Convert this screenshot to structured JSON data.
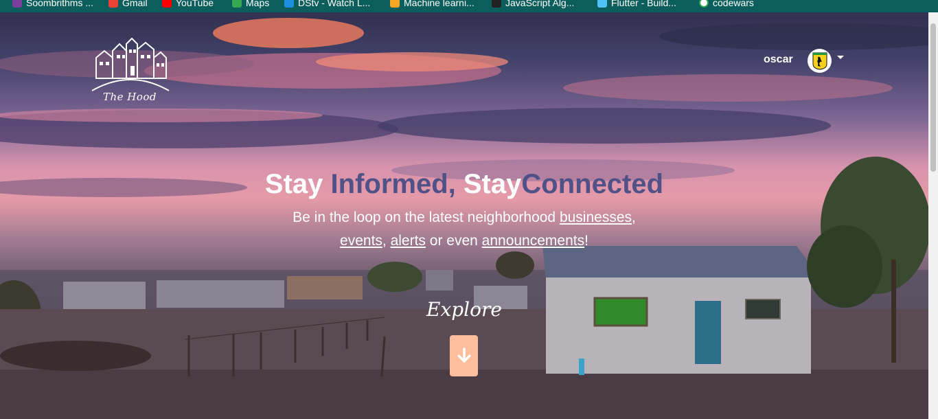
{
  "browser": {
    "bookmarks": [
      {
        "label": "Soombrithms ...",
        "icon": "music-icon"
      },
      {
        "label": "Gmail",
        "icon": "gmail-icon"
      },
      {
        "label": "YouTube",
        "icon": "youtube-icon"
      },
      {
        "label": "Maps",
        "icon": "maps-icon"
      },
      {
        "label": "DStv - Watch L...",
        "icon": "dstv-icon"
      },
      {
        "label": "Machine learni...",
        "icon": "ml-icon"
      },
      {
        "label": "JavaScript Alg...",
        "icon": "code-icon"
      },
      {
        "label": "Flutter - Build...",
        "icon": "flutter-icon"
      },
      {
        "label": "codewars",
        "icon": "codewars-icon"
      }
    ]
  },
  "nav": {
    "logo_text": "The Hood",
    "username": "oscar"
  },
  "hero": {
    "headline": {
      "part1": "Stay ",
      "part2": "Informed, ",
      "part3": "Stay",
      "part4": "Connected"
    },
    "tagline": {
      "intro": "Be in the loop on the latest neighborhood ",
      "link_businesses": "businesses",
      "sep1": ",",
      "link_events": "events",
      "sep2": ", ",
      "link_alerts": "alerts",
      "middle": " or even ",
      "link_announcements": "announcements",
      "end": "!"
    },
    "explore_label": "Explore"
  },
  "colors": {
    "bookmark_bar": "#0b5e5c",
    "headline_accent": "#4f5187",
    "explore_button": "#ffbf9f"
  }
}
